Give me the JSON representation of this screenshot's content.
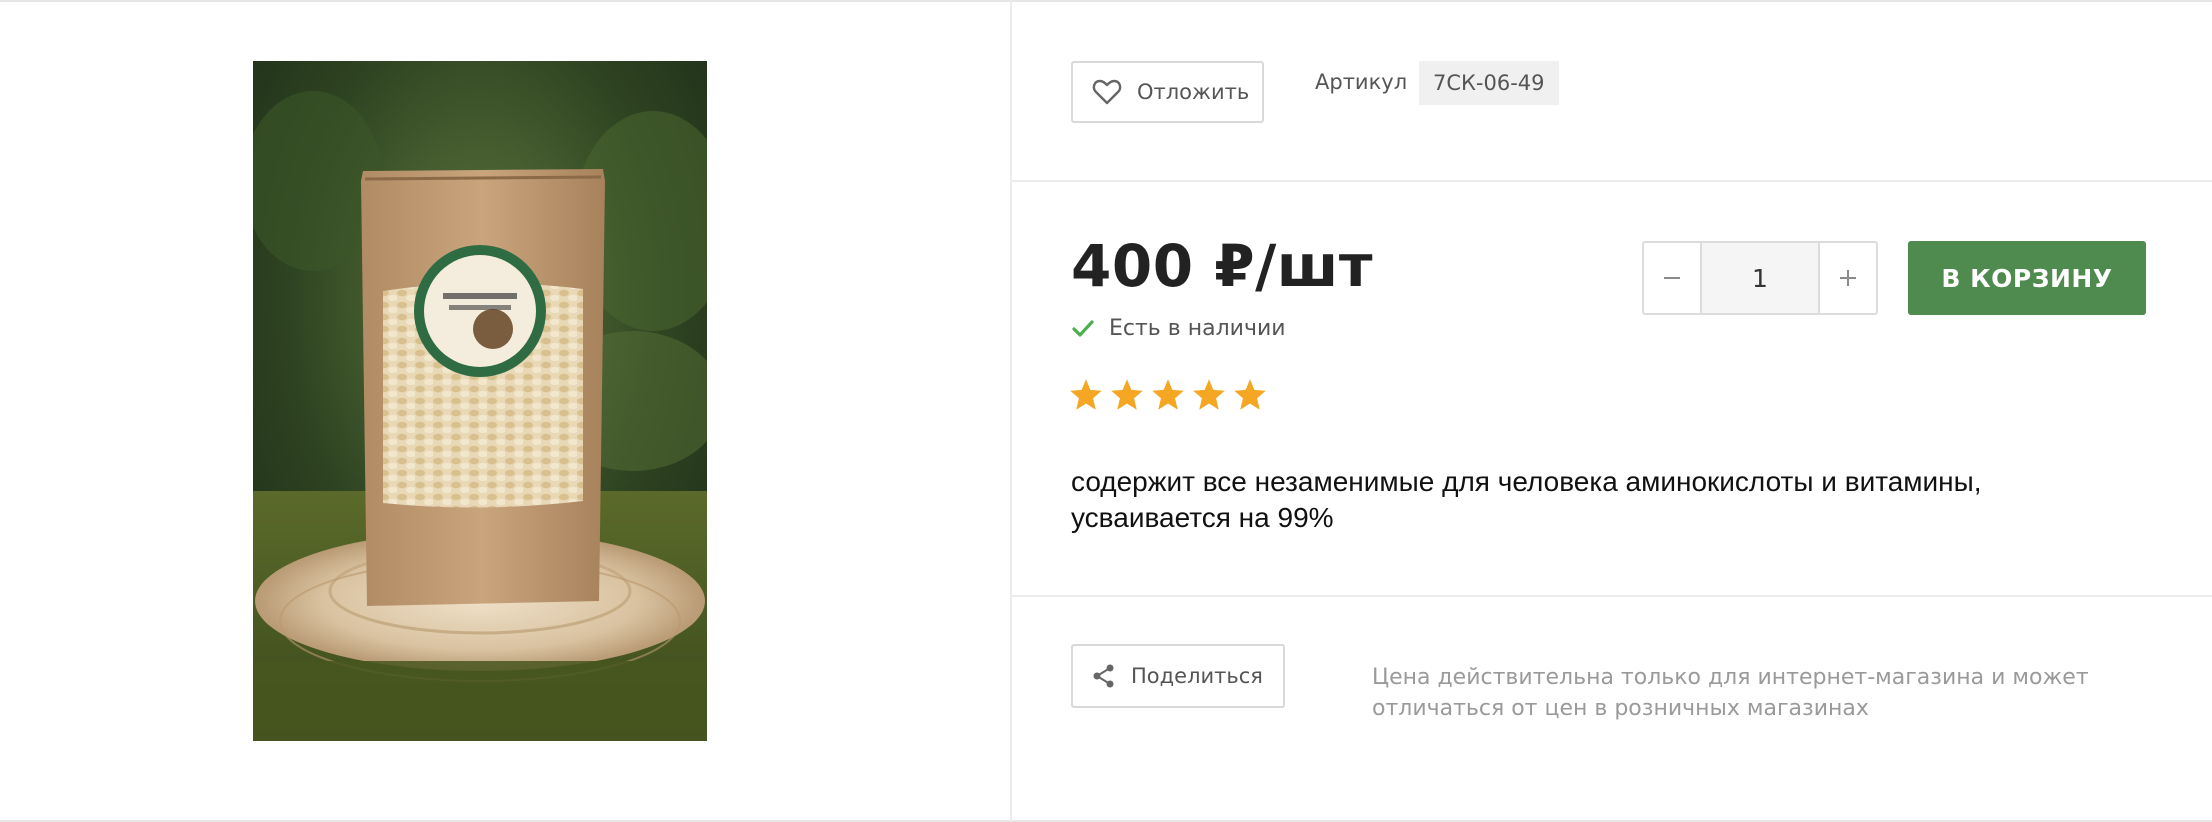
{
  "product": {
    "wishlist_label": "Отложить",
    "sku_label": "Артикул",
    "sku_value": "7СК-06-49",
    "price": "400 ₽/шт",
    "stock_status": "Есть в наличии",
    "rating": 5,
    "rating_max": 5,
    "description": "содержит все незаменимые для человека аминокислоты и витамины, усваивается на 99%",
    "quantity": "1",
    "add_to_cart_label": "В КОРЗИНУ",
    "share_label": "Поделиться",
    "price_note": "Цена действительна только для интернет-магазина и может отличаться от цен в розничных магазинах"
  },
  "colors": {
    "accent_green": "#4f8a4f",
    "check_green": "#4caf50",
    "star_orange": "#f5a623"
  },
  "icons": {
    "wishlist": "heart-icon",
    "stock": "check-icon",
    "share": "share-icon",
    "minus": "minus-icon",
    "plus": "plus-icon"
  }
}
